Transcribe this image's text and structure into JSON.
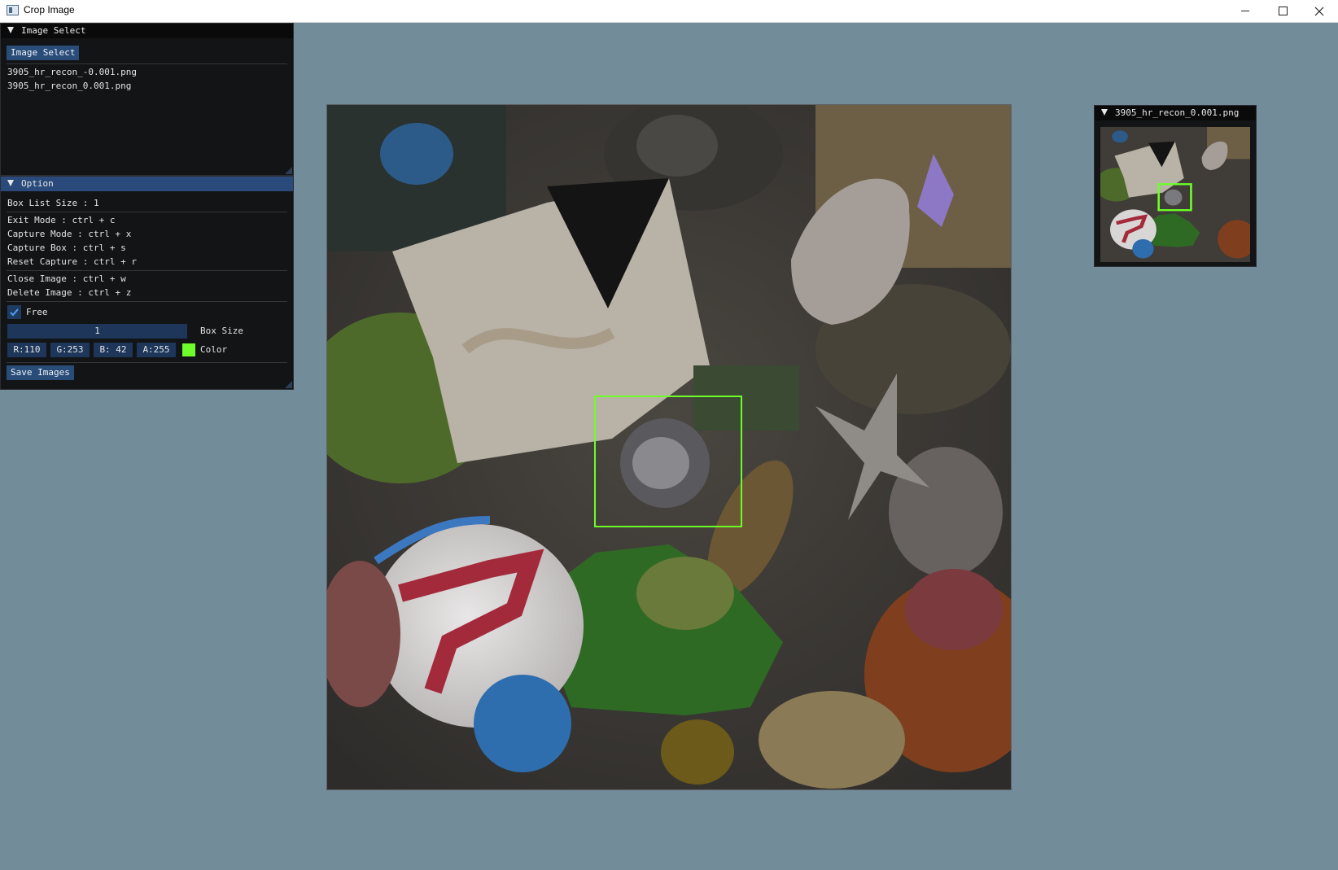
{
  "window": {
    "title": "Crop Image",
    "controls": [
      "minimize-icon",
      "maximize-icon",
      "close-icon"
    ]
  },
  "image_select_panel": {
    "header": "Image Select",
    "button_label": "Image Select",
    "files": [
      "3905_hr_recon_-0.001.png",
      "3905_hr_recon_0.001.png"
    ]
  },
  "option_panel": {
    "header": "Option",
    "box_list_size": "Box List Size : 1",
    "shortcuts": [
      "Exit Mode : ctrl + c",
      "Capture Mode : ctrl + x",
      "Capture Box : ctrl + s",
      "Reset Capture : ctrl + r",
      "Close Image : ctrl + w",
      "Delete Image : ctrl + z"
    ],
    "free_checkbox": {
      "label": "Free",
      "checked": true
    },
    "box_size": {
      "value": "1",
      "label": "Box Size"
    },
    "color": {
      "r": "R:110",
      "g": "G:253",
      "b": "B: 42",
      "a": "A:255",
      "label": "Color",
      "hex": "#6efd2a"
    },
    "save_button": "Save Images"
  },
  "preview_panel": {
    "header": "3905_hr_recon_0.001.png"
  },
  "colors": {
    "background": "#738c99",
    "panel": "#131416",
    "header_active": "#294a7a",
    "button": "#2a4c78",
    "crop_box": "#6efd2a"
  }
}
